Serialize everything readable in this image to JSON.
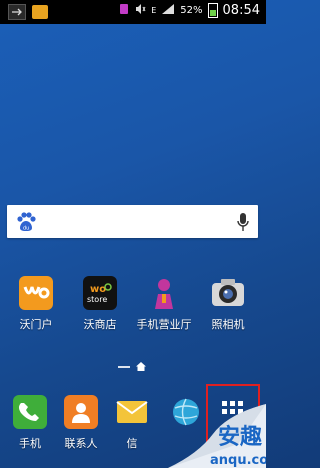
{
  "statusbar": {
    "battery_percent": "52%",
    "time": "08:54",
    "network_label": "E"
  },
  "search": {
    "icon": "baidu-paw-icon",
    "mic_icon": "mic-icon"
  },
  "home_apps": [
    {
      "label": "沃门户",
      "icon": "wo-portal-icon"
    },
    {
      "label": "沃商店",
      "icon": "wo-store-icon"
    },
    {
      "label": "手机营业厅",
      "icon": "mobile-hall-icon"
    },
    {
      "label": "照相机",
      "icon": "camera-icon"
    }
  ],
  "dock": [
    {
      "label": "手机",
      "icon": "phone-icon"
    },
    {
      "label": "联系人",
      "icon": "contacts-icon"
    },
    {
      "label": "信",
      "icon": "messages-icon"
    },
    {
      "label": "",
      "icon": "internet-icon"
    },
    {
      "label": "",
      "icon": "apps-grid-icon"
    }
  ],
  "watermark": {
    "main": "安趣",
    "url": "anqu.com"
  },
  "colors": {
    "wo_orange": "#f39a1e",
    "accent_red": "#e02020"
  }
}
